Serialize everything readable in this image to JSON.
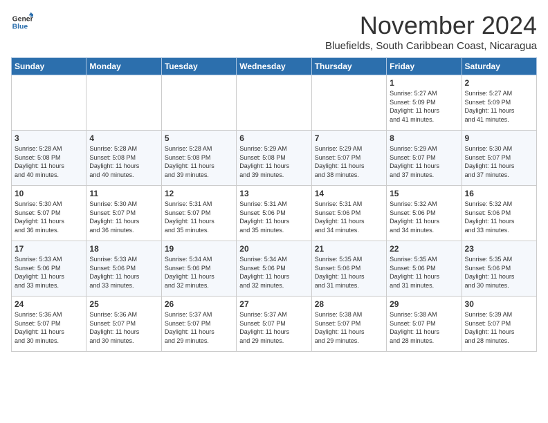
{
  "header": {
    "logo_general": "General",
    "logo_blue": "Blue",
    "month_title": "November 2024",
    "location": "Bluefields, South Caribbean Coast, Nicaragua"
  },
  "weekdays": [
    "Sunday",
    "Monday",
    "Tuesday",
    "Wednesday",
    "Thursday",
    "Friday",
    "Saturday"
  ],
  "weeks": [
    [
      {
        "day": "",
        "info": ""
      },
      {
        "day": "",
        "info": ""
      },
      {
        "day": "",
        "info": ""
      },
      {
        "day": "",
        "info": ""
      },
      {
        "day": "",
        "info": ""
      },
      {
        "day": "1",
        "info": "Sunrise: 5:27 AM\nSunset: 5:09 PM\nDaylight: 11 hours\nand 41 minutes."
      },
      {
        "day": "2",
        "info": "Sunrise: 5:27 AM\nSunset: 5:09 PM\nDaylight: 11 hours\nand 41 minutes."
      }
    ],
    [
      {
        "day": "3",
        "info": "Sunrise: 5:28 AM\nSunset: 5:08 PM\nDaylight: 11 hours\nand 40 minutes."
      },
      {
        "day": "4",
        "info": "Sunrise: 5:28 AM\nSunset: 5:08 PM\nDaylight: 11 hours\nand 40 minutes."
      },
      {
        "day": "5",
        "info": "Sunrise: 5:28 AM\nSunset: 5:08 PM\nDaylight: 11 hours\nand 39 minutes."
      },
      {
        "day": "6",
        "info": "Sunrise: 5:29 AM\nSunset: 5:08 PM\nDaylight: 11 hours\nand 39 minutes."
      },
      {
        "day": "7",
        "info": "Sunrise: 5:29 AM\nSunset: 5:07 PM\nDaylight: 11 hours\nand 38 minutes."
      },
      {
        "day": "8",
        "info": "Sunrise: 5:29 AM\nSunset: 5:07 PM\nDaylight: 11 hours\nand 37 minutes."
      },
      {
        "day": "9",
        "info": "Sunrise: 5:30 AM\nSunset: 5:07 PM\nDaylight: 11 hours\nand 37 minutes."
      }
    ],
    [
      {
        "day": "10",
        "info": "Sunrise: 5:30 AM\nSunset: 5:07 PM\nDaylight: 11 hours\nand 36 minutes."
      },
      {
        "day": "11",
        "info": "Sunrise: 5:30 AM\nSunset: 5:07 PM\nDaylight: 11 hours\nand 36 minutes."
      },
      {
        "day": "12",
        "info": "Sunrise: 5:31 AM\nSunset: 5:07 PM\nDaylight: 11 hours\nand 35 minutes."
      },
      {
        "day": "13",
        "info": "Sunrise: 5:31 AM\nSunset: 5:06 PM\nDaylight: 11 hours\nand 35 minutes."
      },
      {
        "day": "14",
        "info": "Sunrise: 5:31 AM\nSunset: 5:06 PM\nDaylight: 11 hours\nand 34 minutes."
      },
      {
        "day": "15",
        "info": "Sunrise: 5:32 AM\nSunset: 5:06 PM\nDaylight: 11 hours\nand 34 minutes."
      },
      {
        "day": "16",
        "info": "Sunrise: 5:32 AM\nSunset: 5:06 PM\nDaylight: 11 hours\nand 33 minutes."
      }
    ],
    [
      {
        "day": "17",
        "info": "Sunrise: 5:33 AM\nSunset: 5:06 PM\nDaylight: 11 hours\nand 33 minutes."
      },
      {
        "day": "18",
        "info": "Sunrise: 5:33 AM\nSunset: 5:06 PM\nDaylight: 11 hours\nand 33 minutes."
      },
      {
        "day": "19",
        "info": "Sunrise: 5:34 AM\nSunset: 5:06 PM\nDaylight: 11 hours\nand 32 minutes."
      },
      {
        "day": "20",
        "info": "Sunrise: 5:34 AM\nSunset: 5:06 PM\nDaylight: 11 hours\nand 32 minutes."
      },
      {
        "day": "21",
        "info": "Sunrise: 5:35 AM\nSunset: 5:06 PM\nDaylight: 11 hours\nand 31 minutes."
      },
      {
        "day": "22",
        "info": "Sunrise: 5:35 AM\nSunset: 5:06 PM\nDaylight: 11 hours\nand 31 minutes."
      },
      {
        "day": "23",
        "info": "Sunrise: 5:35 AM\nSunset: 5:06 PM\nDaylight: 11 hours\nand 30 minutes."
      }
    ],
    [
      {
        "day": "24",
        "info": "Sunrise: 5:36 AM\nSunset: 5:07 PM\nDaylight: 11 hours\nand 30 minutes."
      },
      {
        "day": "25",
        "info": "Sunrise: 5:36 AM\nSunset: 5:07 PM\nDaylight: 11 hours\nand 30 minutes."
      },
      {
        "day": "26",
        "info": "Sunrise: 5:37 AM\nSunset: 5:07 PM\nDaylight: 11 hours\nand 29 minutes."
      },
      {
        "day": "27",
        "info": "Sunrise: 5:37 AM\nSunset: 5:07 PM\nDaylight: 11 hours\nand 29 minutes."
      },
      {
        "day": "28",
        "info": "Sunrise: 5:38 AM\nSunset: 5:07 PM\nDaylight: 11 hours\nand 29 minutes."
      },
      {
        "day": "29",
        "info": "Sunrise: 5:38 AM\nSunset: 5:07 PM\nDaylight: 11 hours\nand 28 minutes."
      },
      {
        "day": "30",
        "info": "Sunrise: 5:39 AM\nSunset: 5:07 PM\nDaylight: 11 hours\nand 28 minutes."
      }
    ]
  ]
}
